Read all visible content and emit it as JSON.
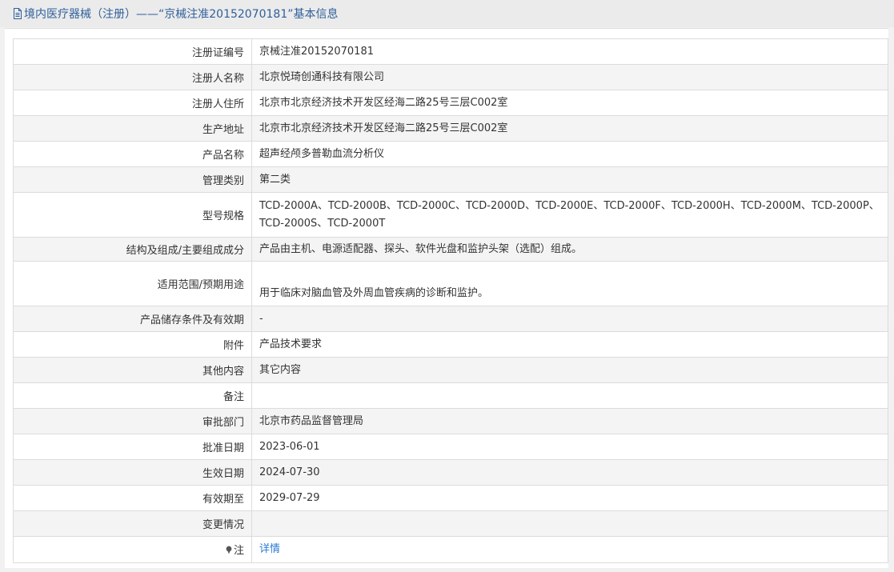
{
  "header": {
    "title": "境内医疗器械（注册）——“京械注准20152070181”基本信息"
  },
  "rows": [
    {
      "label": "注册证编号",
      "value": "京械注准20152070181"
    },
    {
      "label": "注册人名称",
      "value": "北京悦琦创通科技有限公司"
    },
    {
      "label": "注册人住所",
      "value": "北京市北京经济技术开发区经海二路25号三层C002室"
    },
    {
      "label": "生产地址",
      "value": "北京市北京经济技术开发区经海二路25号三层C002室"
    },
    {
      "label": "产品名称",
      "value": "超声经颅多普勒血流分析仪"
    },
    {
      "label": "管理类别",
      "value": "第二类"
    },
    {
      "label": "型号规格",
      "value": "TCD-2000A、TCD-2000B、TCD-2000C、TCD-2000D、TCD-2000E、TCD-2000F、TCD-2000H、TCD-2000M、TCD-2000P、TCD-2000S、TCD-2000T"
    },
    {
      "label": "结构及组成/主要组成成分",
      "value": "产品由主机、电源适配器、探头、软件光盘和监护头架（选配）组成。"
    },
    {
      "label": "适用范围/预期用途",
      "value": "用于临床对脑血管及外周血管疾病的诊断和监护。"
    },
    {
      "label": "产品储存条件及有效期",
      "value": "-"
    },
    {
      "label": "附件",
      "value": "产品技术要求"
    },
    {
      "label": "其他内容",
      "value": "其它内容"
    },
    {
      "label": "备注",
      "value": ""
    },
    {
      "label": "审批部门",
      "value": "北京市药品监督管理局"
    },
    {
      "label": "批准日期",
      "value": "2023-06-01"
    },
    {
      "label": "生效日期",
      "value": "2024-07-30"
    },
    {
      "label": "有效期至",
      "value": "2029-07-29"
    },
    {
      "label": "变更情况",
      "value": ""
    },
    {
      "label": "注",
      "value": "详情"
    }
  ],
  "colors": {
    "title": "#2f5f9c",
    "link": "#2a7ad6",
    "stripe": "#f4f4f4",
    "border": "#dcdcdc"
  },
  "icons": [
    "document-icon",
    "pin-icon"
  ]
}
